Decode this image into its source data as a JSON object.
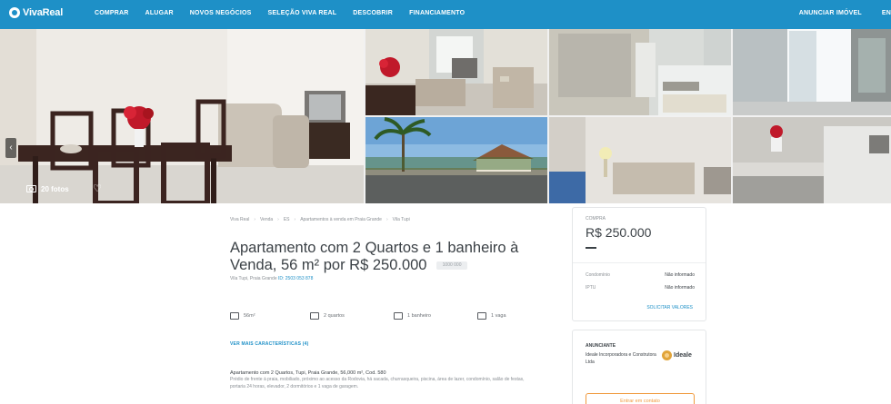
{
  "nav": {
    "logo": "VivaReal",
    "links": [
      "COMPRAR",
      "ALUGAR",
      "NOVOS NEGÓCIOS",
      "SELEÇÃO VIVA REAL",
      "DESCOBRIR",
      "FINANCIAMENTO"
    ],
    "right_links": [
      "ANUNCIAR IMÓVEL",
      "EN"
    ]
  },
  "gallery": {
    "photos_count_label": "20 fotos",
    "prev_arrow": "‹"
  },
  "breadcrumb": [
    "Viva Real",
    "Venda",
    "ES",
    "Apartamentos à venda em Praia Grande",
    "Vila Tupi"
  ],
  "listing": {
    "title": "Apartamento com 2 Quartos e 1 banheiro à Venda, 56 m² por R$ 250.000",
    "code_badge": "1000 000",
    "address": "Vila Tupi, Praia Grande",
    "ref": "ID: 2503 053 878",
    "features": [
      "56m²",
      "2 quartos",
      "1 banheiro",
      "1 vaga"
    ],
    "more_link": "VER MAIS CARACTERÍSTICAS (4)",
    "description_title": "Apartamento com 2 Quartos, Tupi, Praia Grande, 56,000 m², Cod. 580",
    "description_body": "Prédio de frente à praia, mobiliado, próximo ao acesso da Rodovia, há sacada, churrasqueira, piscina, área de lazer, condomínio, salão de festas, portaria 24 horas, elevador, 2 dormitórios e 1 vaga de garagem."
  },
  "price_card": {
    "label": "COMPRA",
    "price": "R$ 250.000",
    "rows": [
      {
        "key": "Condomínio",
        "value": "Não informado"
      },
      {
        "key": "IPTU",
        "value": "Não informado"
      }
    ],
    "link": "SOLICITAR VALORES"
  },
  "advertiser_card": {
    "label": "ANUNCIANTE",
    "name": "Ideale Incorporadora e Construtora Ltda",
    "logo_text": "Ideale",
    "contact_button": "Entrar em contato"
  },
  "colors": {
    "brand_blue": "#1e90c7",
    "accent_orange": "#f09a3e"
  }
}
